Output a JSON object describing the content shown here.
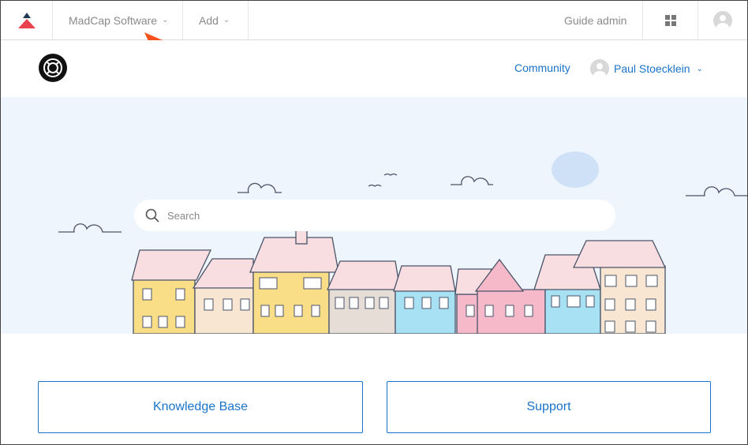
{
  "admin_bar": {
    "brand_label": "MadCap Software",
    "add_label": "Add",
    "guide_admin_label": "Guide admin",
    "apps_icon": "grid-icon",
    "avatar_icon": "user-avatar-icon"
  },
  "site_header": {
    "community_label": "Community",
    "user_name": "Paul Stoecklein"
  },
  "hero": {
    "search_placeholder": "Search"
  },
  "tiles": {
    "knowledge_base_label": "Knowledge Base",
    "support_label": "Support"
  },
  "colors": {
    "link_blue": "#1a73c8",
    "hero_bg": "#eef5fc",
    "logo_red": "#e8434f",
    "pointer_orange": "#f4511e"
  }
}
